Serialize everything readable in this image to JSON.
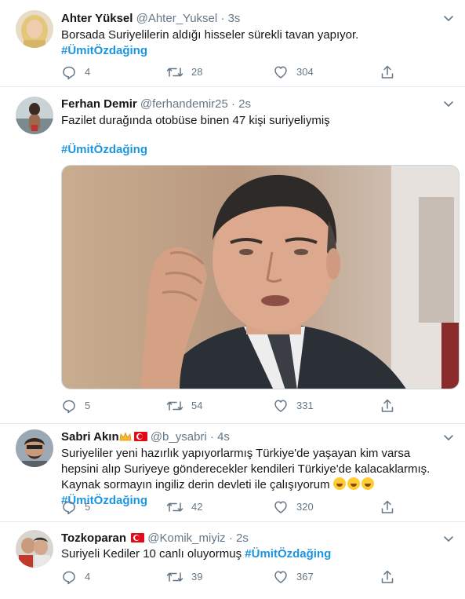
{
  "tweets": [
    {
      "name": "Ahter Yüksel",
      "handle": "@Ahter_Yuksel",
      "sep": "·",
      "time": "3s",
      "text": "Borsada Suriyelilerin aldığı hisseler sürekli tavan yapıyor.",
      "hashtag": "#ÜmitÖzdağing",
      "replies": "4",
      "retweets": "28",
      "likes": "304"
    },
    {
      "name": "Ferhan Demir",
      "handle": "@ferhandemir25",
      "sep": "·",
      "time": "2s",
      "text": "Fazilet durağında otobüse binen 47 kişi suriyeliymiş",
      "hashtag": "#ÜmitÖzdağing",
      "replies": "5",
      "retweets": "54",
      "likes": "331"
    },
    {
      "name": "Sabri Akın",
      "handle": "@b_ysabri",
      "sep": "·",
      "time": "4s",
      "text": "Suriyeliler yeni hazırlık yapıyorlarmış Türkiye'de yaşayan kim varsa hepsini alıp Suriyeye gönderecekler kendileri Türkiye'de kalacaklarmış. Kaynak sormayın ingiliz derin devleti ile çalışıyorum",
      "hashtag": "#ÜmitÖzdağing",
      "replies": "5",
      "retweets": "42",
      "likes": "320"
    },
    {
      "name": "Tozkoparan",
      "handle": "@Komik_miyiz",
      "sep": "·",
      "time": "2s",
      "text": "Suriyeli Kediler 10 canlı oluyormuş",
      "hashtag": "#ÜmitÖzdağing",
      "replies": "4",
      "retweets": "39",
      "likes": "367"
    }
  ],
  "icons": {
    "reply": "reply-icon",
    "retweet": "retweet-icon",
    "like": "heart-icon",
    "share": "share-icon",
    "more": "chevron-down-icon"
  },
  "colors": {
    "hashtag": "#1b95e0",
    "secondary": "#657786",
    "divider": "#e6ecf0"
  }
}
